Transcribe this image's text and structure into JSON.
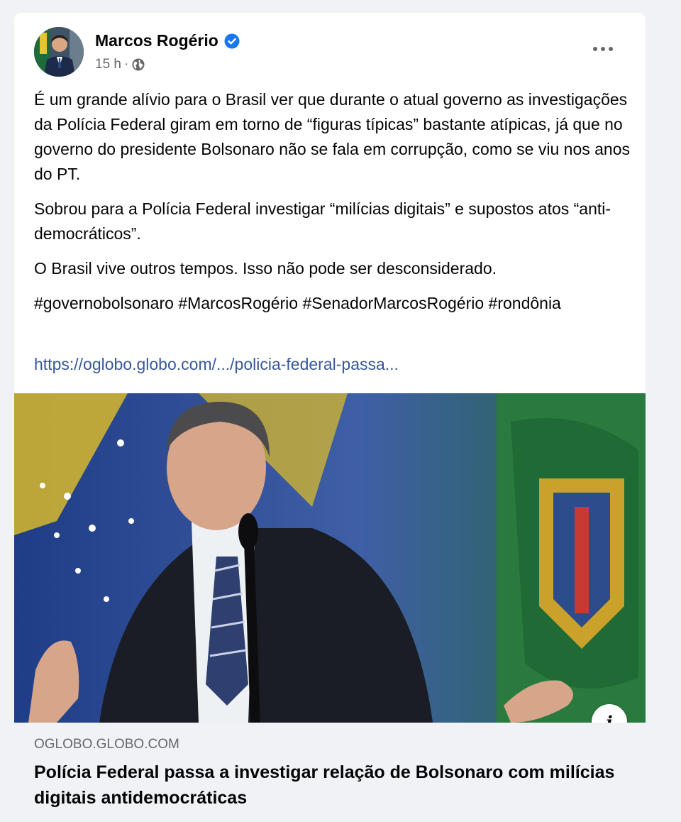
{
  "post": {
    "author": "Marcos Rogério",
    "time": "15 h",
    "separator": "·",
    "paragraphs": [
      "É um grande alívio para o Brasil ver que durante o atual governo as investigações da Polícia Federal giram em torno de “figuras típicas” bastante atípicas, já que no governo do presidente Bolsonaro não se fala em corrupção, como se viu nos anos do PT.",
      "Sobrou para a Polícia Federal investigar “milícias digitais” e supostos atos “anti-democráticos”.",
      "O Brasil vive outros tempos. Isso não pode ser desconsiderado.",
      "#governobolsonaro #MarcosRogério #SenadorMarcosRogério #rondônia"
    ],
    "link": "https://oglobo.globo.com/.../policia-federal-passa..."
  },
  "preview": {
    "domain": "OGLOBO.GLOBO.COM",
    "title": "Polícia Federal passa a investigar relação de Bolsonaro com milícias digitais antidemocráticas",
    "info_label": "i"
  },
  "icons": {
    "verified": "verified-badge-icon",
    "privacy": "globe-icon",
    "more": "more-options-icon",
    "info": "info-icon"
  },
  "colors": {
    "link": "#385898",
    "verified": "#1877f2",
    "meta": "#65676b",
    "background": "#f0f2f5"
  }
}
